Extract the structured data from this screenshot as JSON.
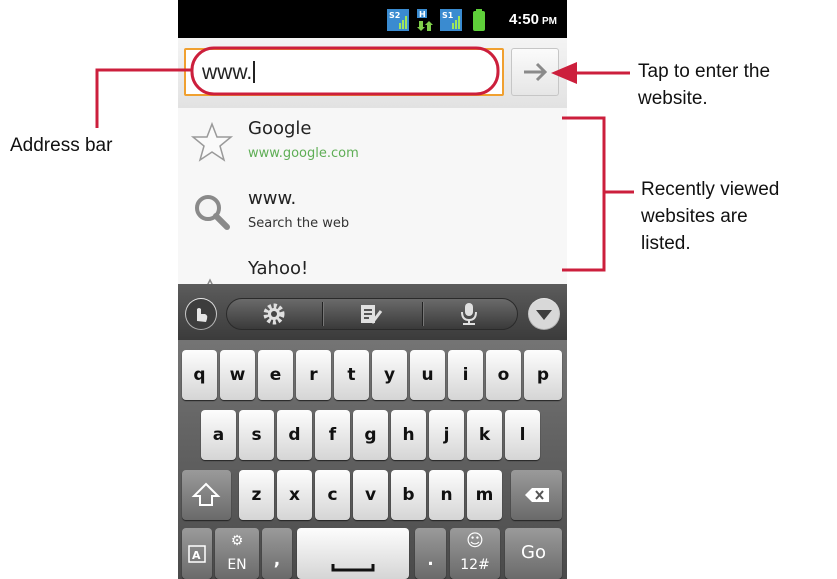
{
  "status_bar": {
    "sim2_label": "S2",
    "data_label": "H",
    "sim1_label": "S1",
    "time": "4:50",
    "ampm": "PM"
  },
  "browser": {
    "url_value": "www.",
    "go_icon": "arrow-right-icon",
    "suggestions": [
      {
        "icon": "star-icon",
        "title": "Google",
        "subtitle": "www.google.com",
        "subtitle_color": "#5fae56"
      },
      {
        "icon": "search-icon",
        "title": "www.",
        "subtitle": "Search the web",
        "subtitle_color": "#333333"
      },
      {
        "icon": "history-icon",
        "title": "Yahoo!",
        "subtitle": "",
        "subtitle_color": "#333333"
      }
    ]
  },
  "keyboard": {
    "toolbar_icons": [
      "touch-input-icon",
      "gear-icon",
      "handwriting-icon",
      "microphone-icon",
      "hide-keyboard-icon"
    ],
    "row1": [
      "q",
      "w",
      "e",
      "r",
      "t",
      "y",
      "u",
      "i",
      "o",
      "p"
    ],
    "row2": [
      "a",
      "s",
      "d",
      "f",
      "g",
      "h",
      "j",
      "k",
      "l"
    ],
    "row3": [
      "z",
      "x",
      "c",
      "v",
      "b",
      "n",
      "m"
    ],
    "lang_label": "EN",
    "comma": ",",
    "period": ".",
    "symbols_label": "12#",
    "go_label": "Go"
  },
  "annotations": {
    "address_bar": "Address bar",
    "tap_enter_line1": "Tap to enter the",
    "tap_enter_line2": "website.",
    "recent_line1": "Recently viewed",
    "recent_line2": "websites are",
    "recent_line3": "listed."
  },
  "colors": {
    "annotation_red": "#cc1f3c",
    "field_focus": "#f0a030"
  }
}
